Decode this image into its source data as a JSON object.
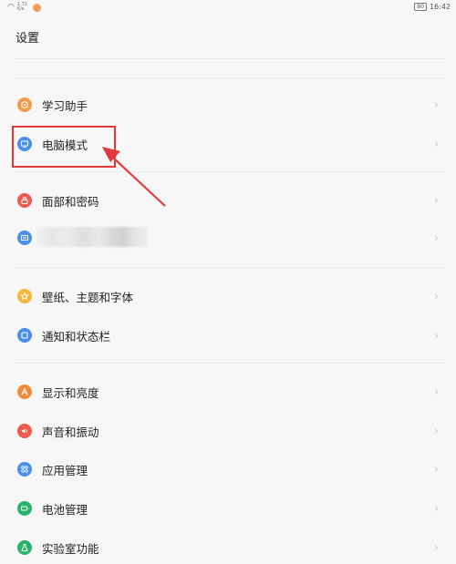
{
  "status_bar": {
    "network_speed": "1.72 K/s",
    "battery_level": "80",
    "time": "16:42",
    "wifi_icon": "wifi-icon",
    "notification_color": "#f59b5a"
  },
  "header": {
    "title": "设置"
  },
  "groups": [
    {
      "items": [
        {
          "label": "学习助手",
          "icon": "study-helper-icon",
          "color": "#f39a4a"
        },
        {
          "label": "电脑模式",
          "icon": "pc-mode-icon",
          "color": "#4a8fe8",
          "highlighted": true
        }
      ]
    },
    {
      "items": [
        {
          "label": "面部和密码",
          "icon": "lock-icon",
          "color": "#ee5a4d"
        },
        {
          "label": "",
          "icon": "account-card-icon",
          "color": "#4a8fe8",
          "redacted": true
        }
      ]
    },
    {
      "items": [
        {
          "label": "壁纸、主题和字体",
          "icon": "theme-star-icon",
          "color": "#f5b735"
        },
        {
          "label": "通知和状态栏",
          "icon": "notification-icon",
          "color": "#4a8fe8"
        }
      ]
    },
    {
      "items": [
        {
          "label": "显示和亮度",
          "icon": "display-icon",
          "color": "#f08a3b"
        },
        {
          "label": "声音和振动",
          "icon": "sound-icon",
          "color": "#ee5a4d"
        },
        {
          "label": "应用管理",
          "icon": "apps-grid-icon",
          "color": "#4a8fe8"
        },
        {
          "label": "电池管理",
          "icon": "battery-icon",
          "color": "#27b46a"
        },
        {
          "label": "实验室功能",
          "icon": "lab-flask-icon",
          "color": "#27b46a"
        }
      ]
    }
  ],
  "annotation": {
    "box_color": "#e23a3a",
    "arrow_color": "#e23a3a"
  }
}
